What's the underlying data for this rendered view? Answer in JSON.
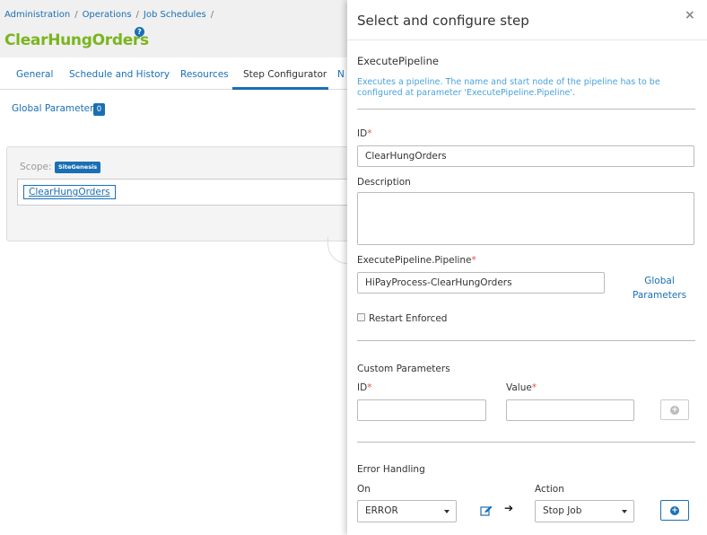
{
  "breadcrumb": [
    "Administration",
    "Operations",
    "Job Schedules"
  ],
  "page": {
    "title": "ClearHungOrders",
    "help_icon": "question-circle-icon"
  },
  "tabs": [
    {
      "label": "General",
      "active": false
    },
    {
      "label": "Schedule and History",
      "active": false
    },
    {
      "label": "Resources",
      "active": false
    },
    {
      "label": "Step Configurator",
      "active": true
    },
    {
      "label": "N",
      "active": false
    }
  ],
  "global_parameters": {
    "label": "Global Parameters",
    "count": "0"
  },
  "scope": {
    "label": "Scope:",
    "site": "SiteGenesis",
    "node": "ClearHungOrders"
  },
  "drawer": {
    "title": "Select and configure step",
    "close_icon": "close-icon",
    "step_name": "ExecutePipeline",
    "step_description": "Executes a pipeline. The name and start node of the pipeline has to be configured at parameter 'ExecutePipeline.Pipeline'.",
    "id_label": "ID",
    "id_value": "ClearHungOrders",
    "description_label": "Description",
    "description_value": "",
    "pipeline_label": "ExecutePipeline.Pipeline",
    "pipeline_value": "HiPayProcess-ClearHungOrders",
    "global_link_line1": "Global",
    "global_link_line2": "Parameters",
    "restart_label": "Restart Enforced",
    "restart_checked": false,
    "custom_params_label": "Custom Parameters",
    "custom_id_label": "ID",
    "custom_value_label": "Value",
    "custom_id_value": "",
    "custom_value_value": "",
    "error_handling_label": "Error Handling",
    "on_label": "On",
    "on_value": "ERROR",
    "action_label": "Action",
    "action_value": "Stop Job",
    "required_marker": "*"
  },
  "colors": {
    "accent": "#1a6fb4",
    "title_green": "#7ab51d",
    "required": "#d9534f",
    "info": "#4aa3df"
  }
}
